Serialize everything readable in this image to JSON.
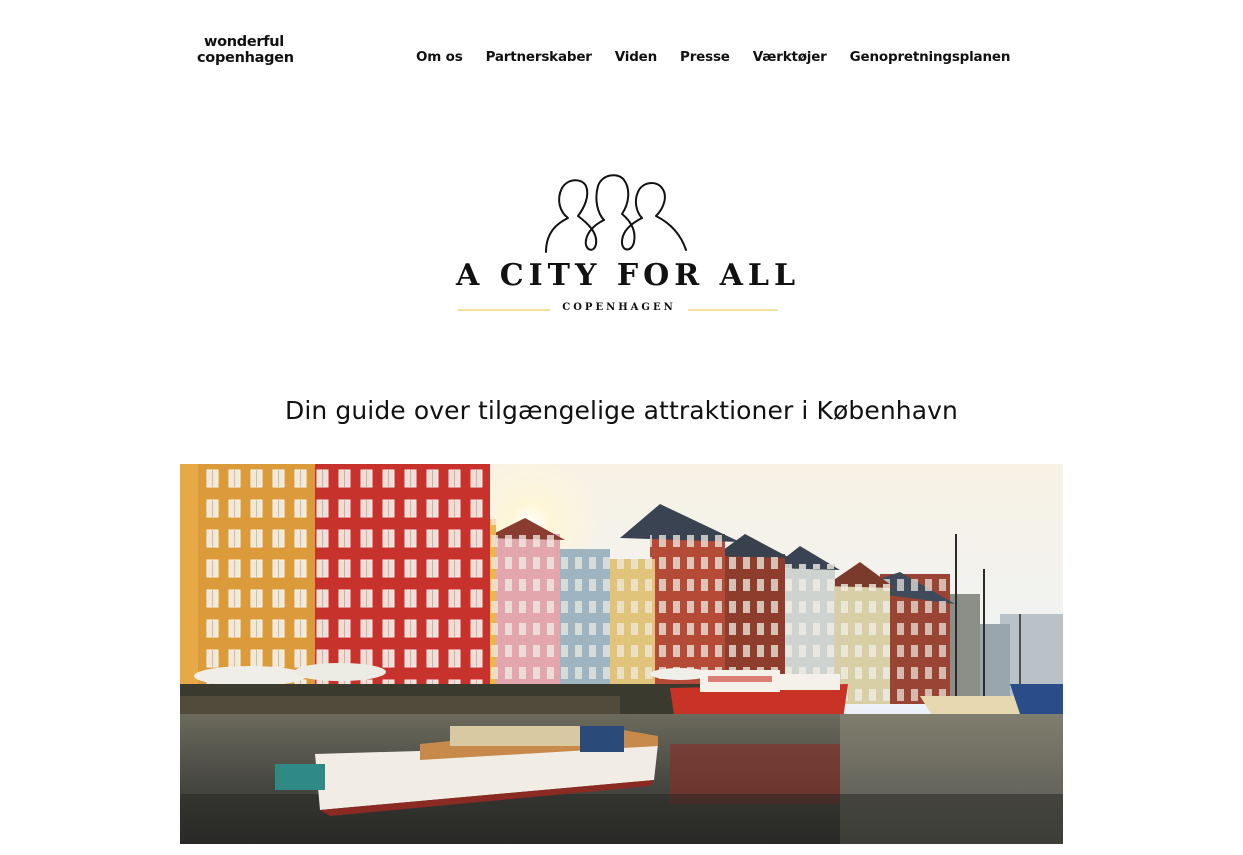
{
  "header": {
    "logo_line1": "wonderful",
    "logo_line2": "copenhagen",
    "nav": [
      {
        "label": "Om os"
      },
      {
        "label": "Partnerskaber"
      },
      {
        "label": "Viden"
      },
      {
        "label": "Presse"
      },
      {
        "label": "Værktøjer"
      },
      {
        "label": "Genopretningsplanen"
      }
    ]
  },
  "brand": {
    "title": "A CITY FOR ALL",
    "subtitle": "COPENHAGEN",
    "rule_color": "#f3dfa0"
  },
  "main": {
    "heading": "Din guide over tilgængelige attraktioner i København"
  },
  "hero": {
    "image_name": "nyhavn-harbour-photo"
  }
}
